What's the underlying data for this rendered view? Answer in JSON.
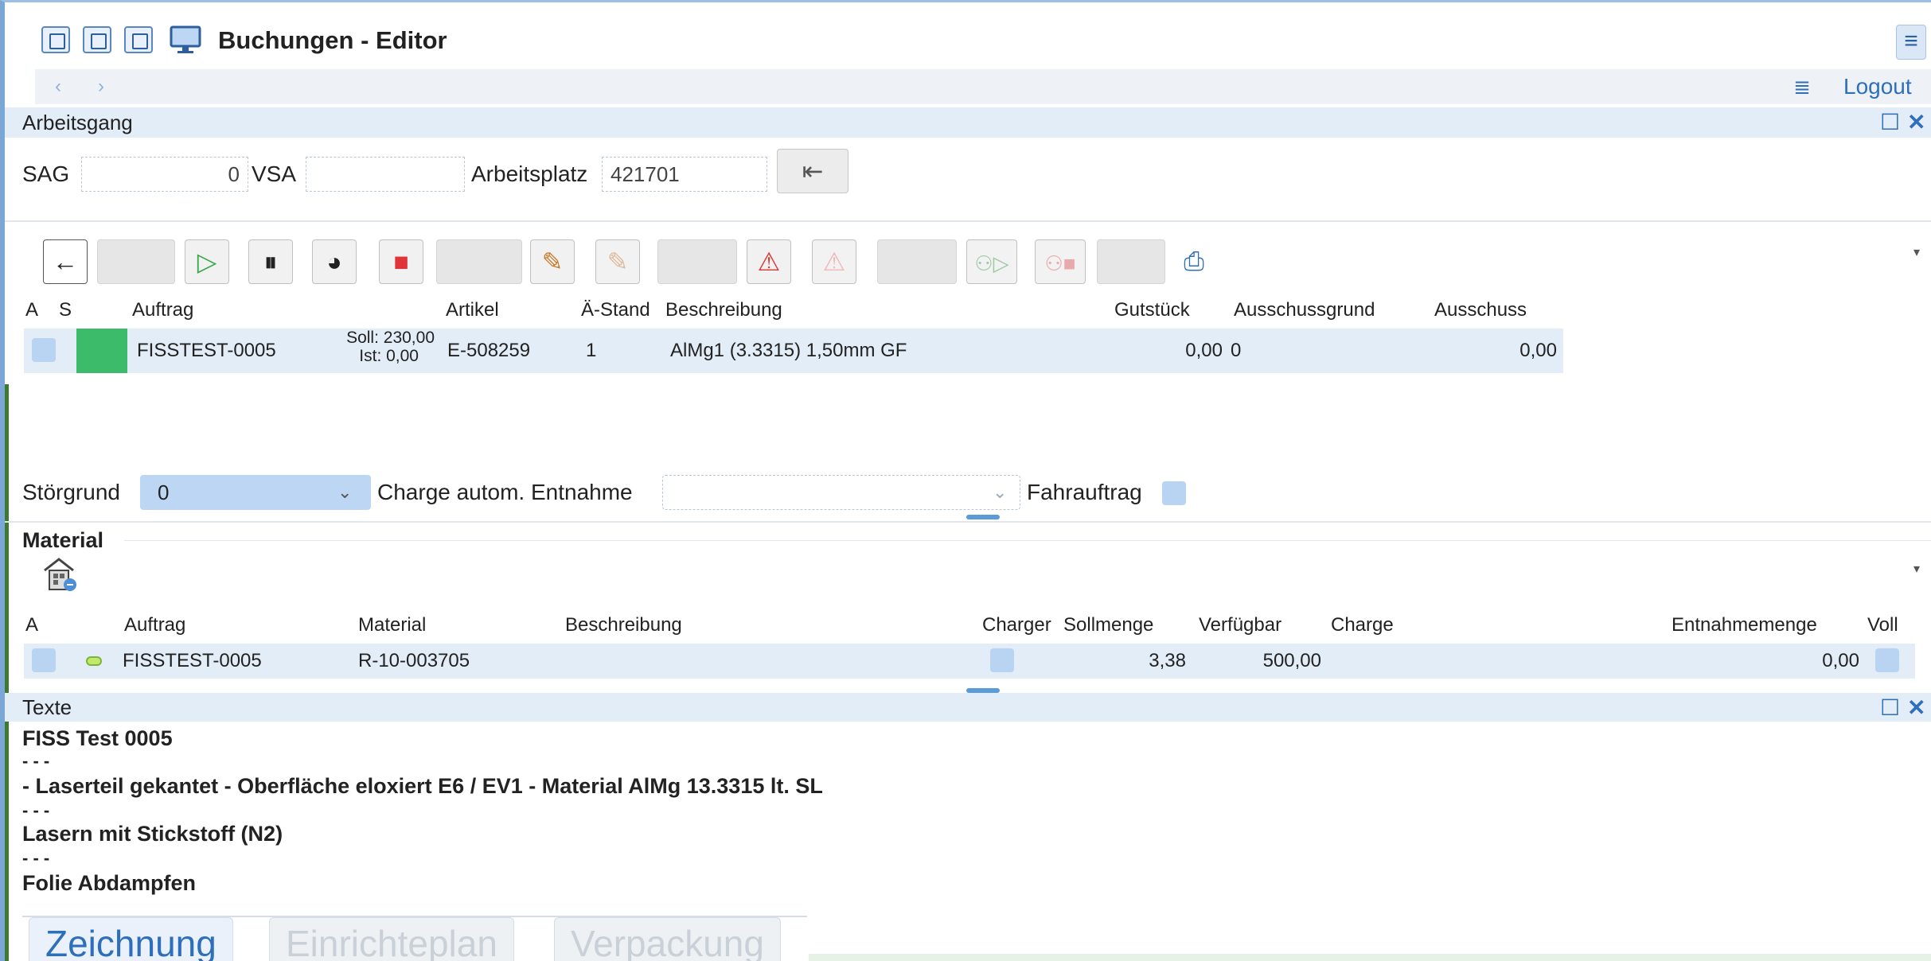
{
  "window": {
    "title": "Buchungen - Editor",
    "logout_label": "Logout"
  },
  "arbeitsgang": {
    "header": "Arbeitsgang",
    "sag_label": "SAG",
    "sag_value": "0",
    "vsa_label": "VSA",
    "vsa_value": "",
    "arbeitsplatz_label": "Arbeitsplatz",
    "arbeitsplatz_value": "421701"
  },
  "orders_table": {
    "columns": [
      "A",
      "S",
      "Auftrag",
      "Artikel",
      "Ä-Stand",
      "Beschreibung",
      "Gutstück",
      "Ausschussgrund",
      "Ausschuss"
    ],
    "row": {
      "auftrag": "FISSTEST-0005",
      "soll": "Soll: 230,00",
      "ist": "Ist: 0,00",
      "artikel": "E-508259",
      "a_stand": "1",
      "beschreibung": "AlMg1 (3.3315) 1,50mm GF",
      "gutstueck": "0,00",
      "ausschussgrund": "0",
      "ausschuss": "0,00"
    },
    "status_color": "#3cbc6a"
  },
  "options": {
    "stoergrund_label": "Störgrund",
    "stoergrund_value": "0",
    "charge_label": "Charge autom. Entnahme",
    "charge_value": "",
    "fahrauftrag_label": "Fahrauftrag"
  },
  "material": {
    "header": "Material",
    "columns": [
      "A",
      "Auftrag",
      "Material",
      "Beschreibung",
      "Charger",
      "Sollmenge",
      "Verfügbar",
      "Charge",
      "Entnahmemenge",
      "Voll"
    ],
    "row": {
      "auftrag": "FISSTEST-0005",
      "material": "R-10-003705",
      "beschreibung": "",
      "sollmenge": "3,38",
      "verfuegbar": "500,00",
      "charge": "",
      "entnahmemenge": "0,00"
    }
  },
  "texte": {
    "header": "Texte",
    "lines": [
      "FISS Test 0005",
      "- - -",
      "- Laserteil gekantet - Oberfläche eloxiert E6 / EV1 - Material AlMg 13.3315 lt. SL",
      "- - -",
      "Lasern mit Stickstoff (N2)",
      "- - -",
      "Folie Abdampfen"
    ]
  },
  "tabs": [
    "Zeichnung",
    "Einrichteplan",
    "Verpackung"
  ],
  "icons": {
    "toolbar": [
      "back-arrow-icon",
      "play-icon",
      "pause-icon",
      "partial-complete-icon",
      "stop-icon",
      "tool-icon",
      "tool-disabled-icon",
      "warning-icon",
      "warning-disabled-icon",
      "person-start-icon",
      "person-stop-icon",
      "print-icon"
    ]
  },
  "colors": {
    "accent": "#2d6fba",
    "header_bg": "#e3edf8",
    "selection": "#e3edf8",
    "checkbox": "#b9d4f3"
  }
}
